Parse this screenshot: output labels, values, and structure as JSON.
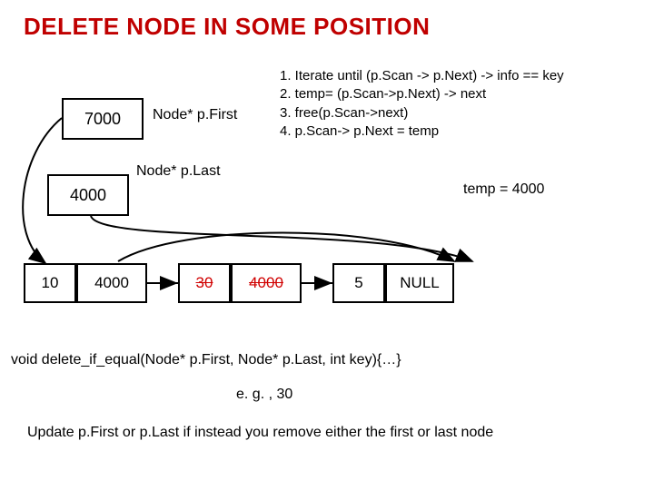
{
  "title": "DELETE NODE IN SOME POSITION",
  "pointers": {
    "first_box": "7000",
    "last_box": "4000",
    "pfirst_label": "Node* p.First",
    "plast_label": "Node* p.Last"
  },
  "steps": {
    "s1": "1.  Iterate until (p.Scan -> p.Next) -> info == key",
    "s2": "2.  temp= (p.Scan->p.Next) -> next",
    "s3": "3.  free(p.Scan->next)",
    "s4": "4.  p.Scan-> p.Next = temp"
  },
  "temp_label": "temp = 4000",
  "nodes": {
    "n1_val": "10",
    "n1_ptr": "4000",
    "n2_val": "30",
    "n2_ptr": "4000",
    "n3_val": "5",
    "n3_null": "NULL"
  },
  "func_signature": "void delete_if_equal(Node* p.First, Node* p.Last, int key){…}",
  "example": "e. g. , 30",
  "update_note": "Update p.First or p.Last if instead you remove either the first or last node"
}
